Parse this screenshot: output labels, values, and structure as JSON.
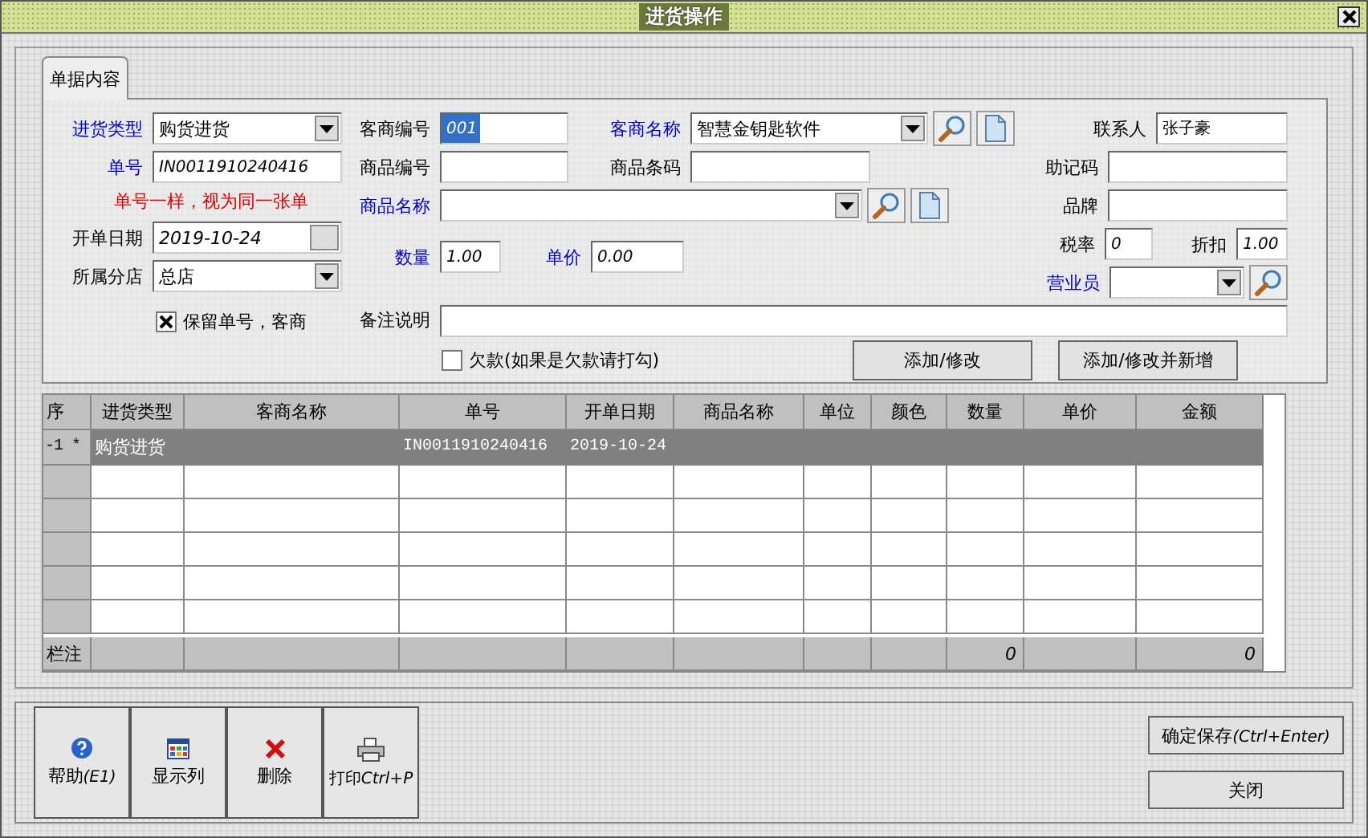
{
  "window": {
    "title": "进货操作"
  },
  "tabs": [
    {
      "label": "单据内容",
      "selected": true
    }
  ],
  "form": {
    "purchase_type": {
      "label": "进货类型",
      "value": "购货进货",
      "link": true
    },
    "order_no": {
      "label": "单号",
      "value": "IN0011910240416",
      "link": true
    },
    "order_note": "单号一样，视为同一张单",
    "order_date": {
      "label": "开单日期",
      "value": "2019-10-24",
      "link": false
    },
    "branch": {
      "label": "所属分店",
      "value": "总店",
      "link": false
    },
    "keep_option": {
      "label": "保留单号，客商",
      "checked": true
    },
    "supplier_code": {
      "label": "客商编号",
      "value": "001",
      "link": false,
      "selected": true
    },
    "supplier_name": {
      "label": "客商名称",
      "value": "智慧金钥匙软件",
      "link": true
    },
    "contact": {
      "label": "联系人",
      "value": "张子豪",
      "link": false
    },
    "product_code": {
      "label": "商品编号",
      "link": false
    },
    "barcode": {
      "label": "商品条码",
      "link": false
    },
    "mnemonic": {
      "label": "助记码",
      "link": false
    },
    "product_name": {
      "label": "商品名称",
      "link": true
    },
    "brand": {
      "label": "品牌",
      "link": false
    },
    "quantity": {
      "label": "数量",
      "value": "1.00",
      "link": true
    },
    "unit_price": {
      "label": "单价",
      "value": "0.00",
      "link": true
    },
    "tax_rate": {
      "label": "税率",
      "value": "0",
      "link": false
    },
    "discount": {
      "label": "折扣",
      "value": "1.00",
      "link": false
    },
    "salesperson": {
      "label": "营业员",
      "link": true
    },
    "remark": {
      "label": "备注说明",
      "link": false
    },
    "credit_option": {
      "label": "欠款(如果是欠款请打勾)",
      "checked": false
    }
  },
  "form_buttons": [
    "添加/修改",
    "添加/修改并新增"
  ],
  "table": {
    "columns": [
      "序",
      "进货类型",
      "客商名称",
      "单号",
      "开单日期",
      "商品名称",
      "单位",
      "颜色",
      "数量",
      "单价",
      "金额"
    ],
    "rows": [
      {
        "selected": true,
        "cells": [
          "-1 *",
          "购货进货",
          "",
          "IN0011910240416",
          "2019-10-24"
        ]
      }
    ],
    "footer": {
      "label": "栏注",
      "quantity_total": "0",
      "amount_total": "0"
    }
  },
  "footer_buttons": [
    {
      "label": "帮助",
      "shortcut": "(E1)",
      "kind": "help"
    },
    {
      "label": "显示列",
      "kind": "columns"
    },
    {
      "label": "删除",
      "kind": "delete"
    },
    {
      "label": "打印",
      "shortcut": "Ctrl+P",
      "kind": "print"
    }
  ],
  "dialog_buttons": [
    {
      "label": "确定保存",
      "shortcut": "(Ctrl+Enter)"
    },
    {
      "label": "关闭"
    }
  ]
}
